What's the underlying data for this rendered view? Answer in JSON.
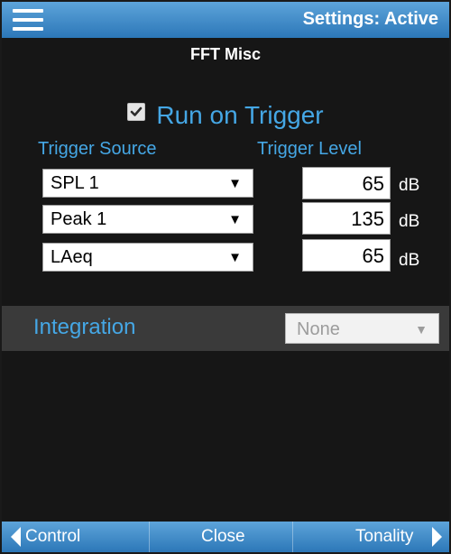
{
  "header": {
    "menu_icon": "hamburger-menu-icon",
    "status": "Settings: Active"
  },
  "page": {
    "title": "FFT Misc"
  },
  "run_on_trigger": {
    "checked": true,
    "label": "Run on Trigger"
  },
  "trigger": {
    "source_header": "Trigger Source",
    "level_header": "Trigger Level",
    "rows": [
      {
        "source": "SPL 1",
        "level": "65",
        "unit": "dB"
      },
      {
        "source": "Peak 1",
        "level": "135",
        "unit": "dB"
      },
      {
        "source": "LAeq",
        "level": "65",
        "unit": "dB"
      }
    ]
  },
  "integration": {
    "label": "Integration",
    "value": "None"
  },
  "footer": {
    "left": "Control",
    "center": "Close",
    "right": "Tonality"
  },
  "colors": {
    "accent": "#45a7e5",
    "header": "#3b8fd0",
    "background": "#161616"
  }
}
